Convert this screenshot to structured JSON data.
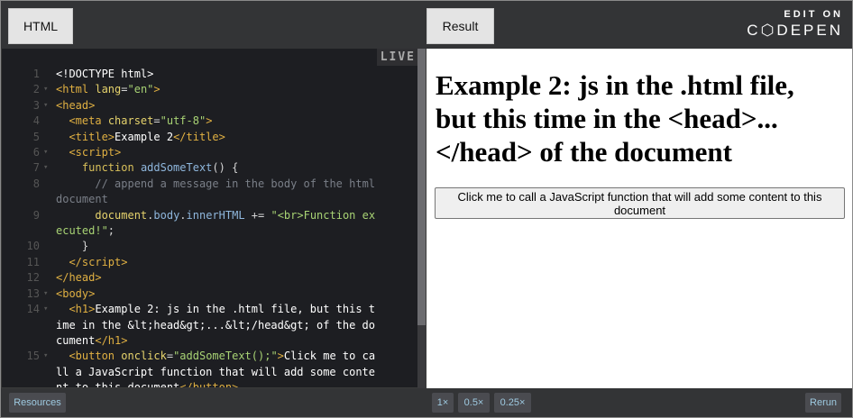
{
  "tabs": {
    "html": "HTML",
    "result": "Result"
  },
  "codepen": {
    "edit_on": "EDIT ON",
    "brand": "C⬡DEPEN"
  },
  "live_label": "LIVE",
  "code_lines": [
    {
      "n": "1",
      "fold": false,
      "html": "<span class='w'>&lt;!DOCTYPE html&gt;</span>"
    },
    {
      "n": "2",
      "fold": true,
      "html": "<span class='t'>&lt;html</span> <span class='a'>lang</span>=<span class='s'>\"en\"</span><span class='t'>&gt;</span>"
    },
    {
      "n": "3",
      "fold": true,
      "html": "<span class='t'>&lt;head&gt;</span>"
    },
    {
      "n": "4",
      "fold": false,
      "html": "  <span class='t'>&lt;meta</span> <span class='a'>charset</span>=<span class='s'>\"utf-8\"</span><span class='t'>&gt;</span>"
    },
    {
      "n": "5",
      "fold": false,
      "html": "  <span class='t'>&lt;title&gt;</span><span class='w'>Example 2</span><span class='t'>&lt;/title&gt;</span>"
    },
    {
      "n": "6",
      "fold": true,
      "html": "  <span class='t'>&lt;script&gt;</span>"
    },
    {
      "n": "7",
      "fold": true,
      "html": "    <span class='k'>function</span> <span class='f'>addSomeText</span>() {"
    },
    {
      "n": "8",
      "fold": false,
      "html": "      <span class='c'>// append a message in the body of the html document</span>"
    },
    {
      "n": "9",
      "fold": false,
      "html": "      <span class='a'>document</span>.<span class='f'>body</span>.<span class='f'>innerHTML</span> += <span class='s'>\"&lt;br&gt;Function executed!\"</span>;"
    },
    {
      "n": "10",
      "fold": false,
      "html": "    }"
    },
    {
      "n": "11",
      "fold": false,
      "html": "  <span class='t'>&lt;/script&gt;</span>"
    },
    {
      "n": "12",
      "fold": false,
      "html": "<span class='t'>&lt;/head&gt;</span>"
    },
    {
      "n": "13",
      "fold": true,
      "html": "<span class='t'>&lt;body&gt;</span>"
    },
    {
      "n": "14",
      "fold": true,
      "html": "  <span class='t'>&lt;h1&gt;</span><span class='w'>Example 2: js in the .html file, but this time in the &amp;lt;head&amp;gt;...&amp;lt;/head&amp;gt; of the document</span><span class='t'>&lt;/h1&gt;</span>"
    },
    {
      "n": "15",
      "fold": true,
      "html": "  <span class='t'>&lt;button</span> <span class='a'>onclick</span>=<span class='s'>\"addSomeText();\"</span><span class='t'>&gt;</span><span class='w'>Click me to call a JavaScript function that will add some content to this document</span><span class='t'>&lt;/button&gt;</span>"
    }
  ],
  "result": {
    "heading": "Example 2: js in the .html file, but this time in the <head>...</head> of the document",
    "button_label": "Click me to call a JavaScript function that will add some content to this document"
  },
  "bottom": {
    "resources": "Resources",
    "zoom_1x": "1×",
    "zoom_05x": "0.5×",
    "zoom_025x": "0.25×",
    "rerun": "Rerun"
  }
}
